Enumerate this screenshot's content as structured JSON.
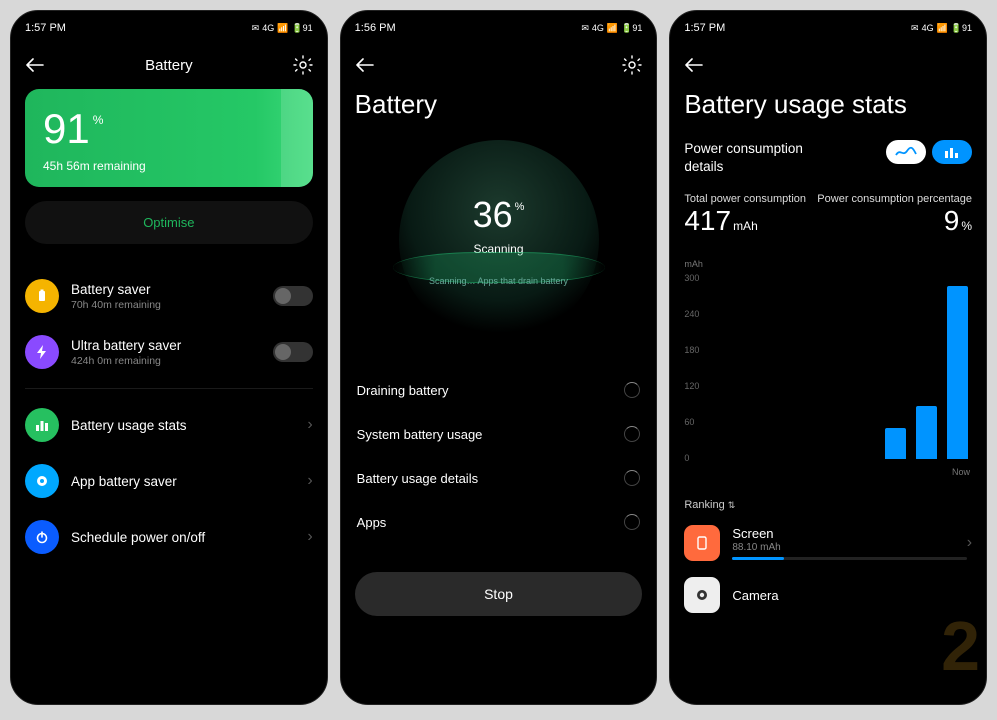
{
  "screen1": {
    "time": "1:57 PM",
    "status_icons": [
      "✉",
      "4G",
      "📶",
      "🔋91"
    ],
    "title": "Battery",
    "battery_pct": "91",
    "battery_pct_sym": "%",
    "battery_remaining": "45h 56m remaining",
    "optimise": "Optimise",
    "saver": {
      "title": "Battery saver",
      "sub": "70h 40m remaining"
    },
    "ultra": {
      "title": "Ultra battery saver",
      "sub": "424h 0m remaining"
    },
    "links": {
      "stats": "Battery usage stats",
      "app_saver": "App battery saver",
      "schedule": "Schedule power on/off"
    }
  },
  "screen2": {
    "time": "1:56 PM",
    "status_icons": [
      "✉",
      "4G",
      "📶",
      "🔋91"
    ],
    "title": "Battery",
    "scan_pct": "36",
    "scan_pct_sym": "%",
    "scan_label": "Scanning",
    "scan_sub": "Scanning… Apps that drain battery",
    "items": {
      "drain": "Draining battery",
      "system": "System battery usage",
      "details": "Battery usage details",
      "apps": "Apps"
    },
    "stop": "Stop"
  },
  "screen3": {
    "time": "1:57 PM",
    "status_icons": [
      "✉",
      "4G",
      "📶",
      "🔋91"
    ],
    "title": "Battery usage stats",
    "pcd_label": "Power consumption details",
    "total_label": "Total power consumption",
    "total_value": "417",
    "total_unit": "mAh",
    "pct_label": "Power consumption percentage",
    "pct_value": "9",
    "pct_unit": "%",
    "y_unit": "mAh",
    "now_label": "Now",
    "ranking": "Ranking",
    "apps": {
      "screen": {
        "name": "Screen",
        "sub": "88.10 mAh"
      },
      "camera": {
        "name": "Camera",
        "sub": ""
      }
    }
  },
  "chart_data": {
    "type": "bar",
    "ylabel": "mAh",
    "yticks": [
      300,
      240,
      180,
      120,
      60,
      0
    ],
    "ylim": [
      0,
      300
    ],
    "x_last_label": "Now",
    "values": [
      50,
      85,
      280
    ]
  },
  "watermark": "2"
}
